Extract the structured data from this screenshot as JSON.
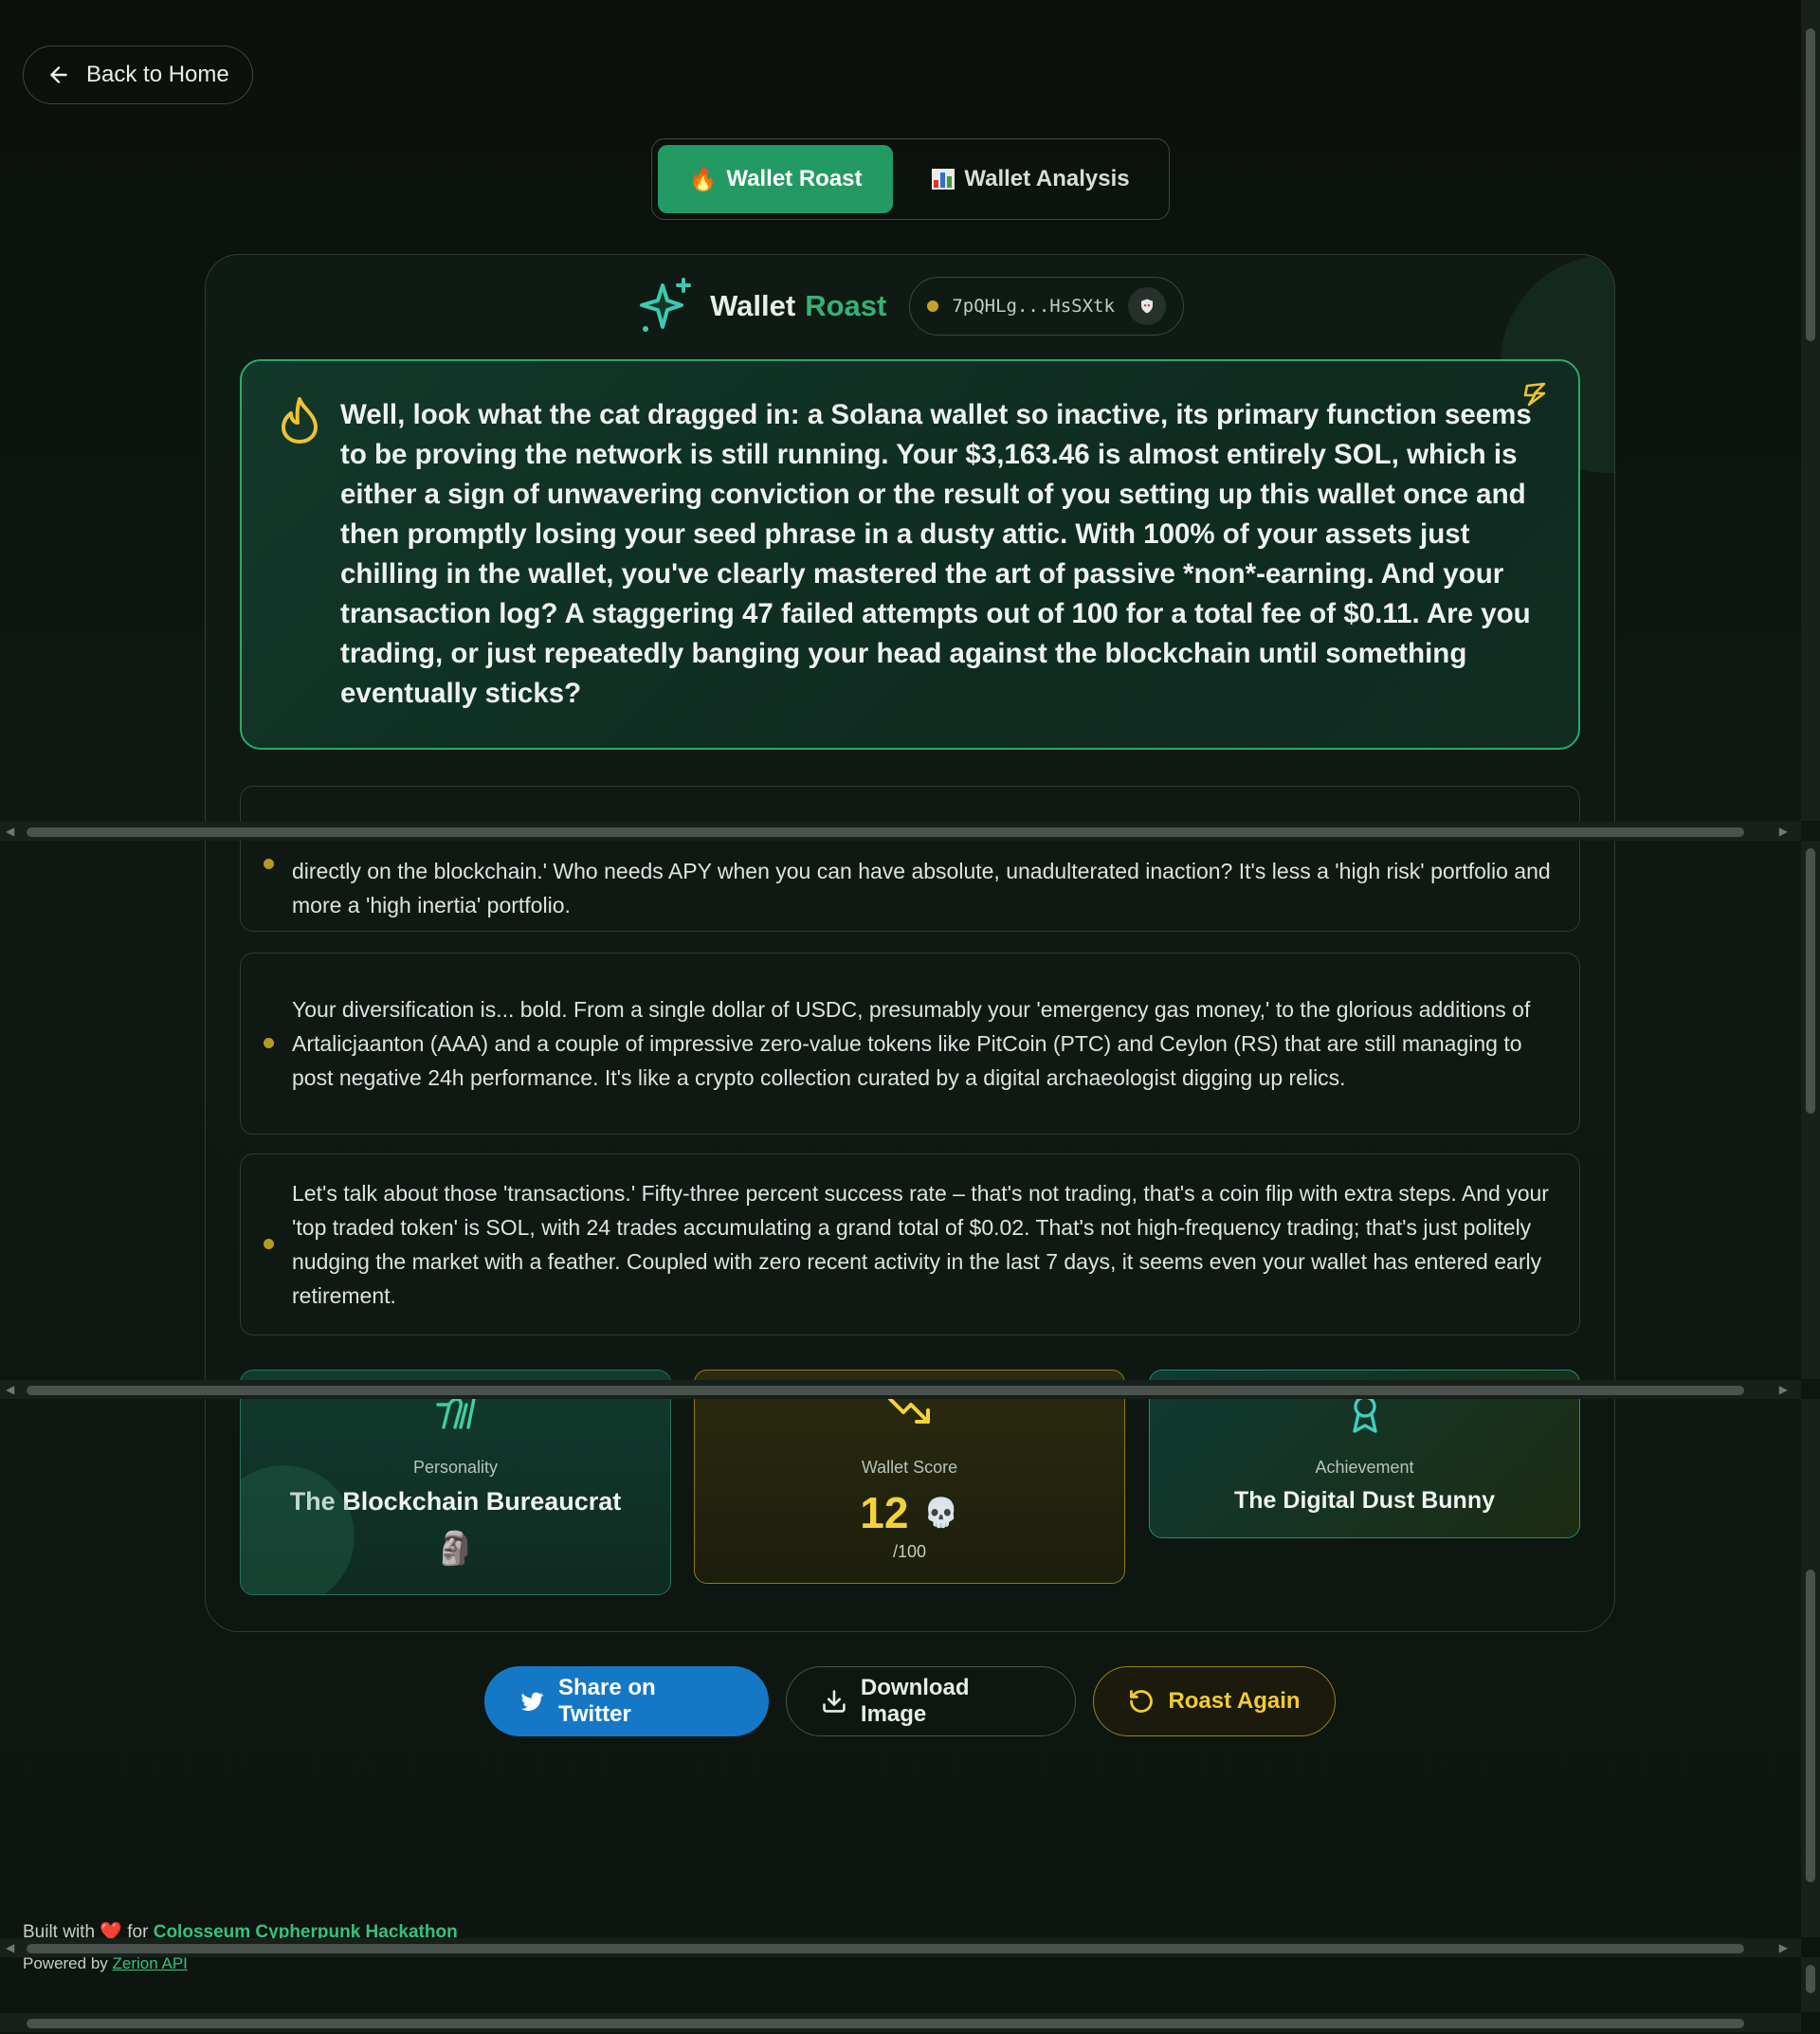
{
  "nav": {
    "back_label": "Back to Home"
  },
  "tabs": [
    {
      "label": "Wallet Roast",
      "emoji": "🔥",
      "active": true
    },
    {
      "label": "Wallet Analysis",
      "icon": "bar-chart-icon",
      "active": false
    }
  ],
  "header": {
    "brand_word1": "Wallet",
    "brand_word2": "Roast",
    "address": "7pQHLg...HsSXtk",
    "address_badge_icon": "shield-icon"
  },
  "roast": {
    "text": "Well, look what the cat dragged in: a Solana wallet so inactive, its primary function seems to be proving the network is still running. Your $3,163.46 is almost entirely SOL, which is either a sign of unwavering conviction or the result of you setting up this wallet once and then promptly losing your seed phrase in a dusty attic. With 100% of your assets just chilling in the wallet, you've clearly mastered the art of passive *non*-earning. And your transaction log? A staggering 47 failed attempts out of 100 for a total fee of $0.11. Are you trading, or just repeatedly banging your head against the blockchain until something eventually sticks?"
  },
  "points": [
    {
      "text": "directly on the blockchain.' Who needs APY when you can have absolute, unadulterated inaction? It's less a 'high risk' portfolio and more a 'high inertia' portfolio."
    },
    {
      "text": "Your diversification is... bold. From a single dollar of USDC, presumably your 'emergency gas money,' to the glorious additions of Artalicjaanton (AAA) and a couple of impressive zero-value tokens like PitCoin (PTC) and Ceylon (RS) that are still managing to post negative 24h performance. It's like a crypto collection curated by a digital archaeologist digging up relics."
    },
    {
      "text": "Let's talk about those 'transactions.' Fifty-three percent success rate – that's not trading, that's a coin flip with extra steps. And your 'top traded token' is SOL, with 24 trades accumulating a grand total of $0.02. That's not high-frequency trading; that's just politely nudging the market with a feather. Coupled with zero recent activity in the last 7 days, it seems even your wallet has entered early retirement."
    }
  ],
  "stats": {
    "personality": {
      "label": "Personality",
      "value": "The Blockchain Bureaucrat",
      "emoji": "🗿"
    },
    "score": {
      "label": "Wallet Score",
      "value": "12",
      "emoji": "💀",
      "denominator": "/100"
    },
    "achievement": {
      "label": "Achievement",
      "value": "The Digital Dust Bunny"
    }
  },
  "actions": {
    "twitter": "Share on Twitter",
    "download": "Download Image",
    "again": "Roast Again"
  },
  "footer": {
    "built_with": "Built with",
    "heart": "❤️",
    "for": "for",
    "hackathon": "Colosseum Cypherpunk Hackathon",
    "powered_by": "Powered by",
    "api": "Zerion API"
  },
  "colors": {
    "accent_green": "#239a63",
    "score_yellow": "#f3d33a",
    "twitter_blue": "#1578c6"
  }
}
